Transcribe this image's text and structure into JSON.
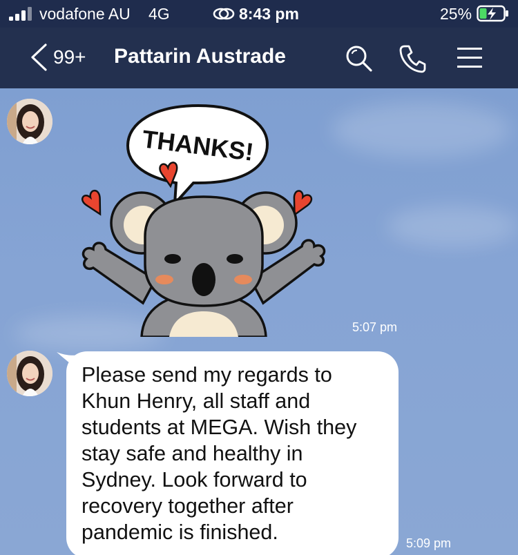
{
  "status_bar": {
    "carrier": "vodafone AU",
    "network": "4G",
    "time": "8:43 pm",
    "battery": "25%",
    "icons": [
      "signal-bars-icon",
      "link-icon",
      "battery-charging-icon"
    ]
  },
  "nav": {
    "unread_count": "99+",
    "title": "Pattarin Austrade",
    "icons": [
      "back-chevron-icon",
      "search-icon",
      "phone-icon",
      "menu-icon"
    ]
  },
  "messages": [
    {
      "type": "sticker",
      "sticker_text": "THANKS!",
      "sticker_subject": "koala-thanks-sticker",
      "time": "5:07 pm"
    },
    {
      "type": "text",
      "text": "Please send my regards to\nKhun Henry, all staff and\nstudents at MEGA. Wish they\nstay safe and healthy in\nSydney. Look forward to\nrecovery together after\npandemic is finished.",
      "time": "5:09 pm"
    }
  ],
  "colors": {
    "header": "#23304f",
    "chat_background": "#86a4d4",
    "bubble": "#ffffff",
    "battery_fill": "#4cd964",
    "heart": "#e8452f",
    "koala": "#8f9094"
  }
}
